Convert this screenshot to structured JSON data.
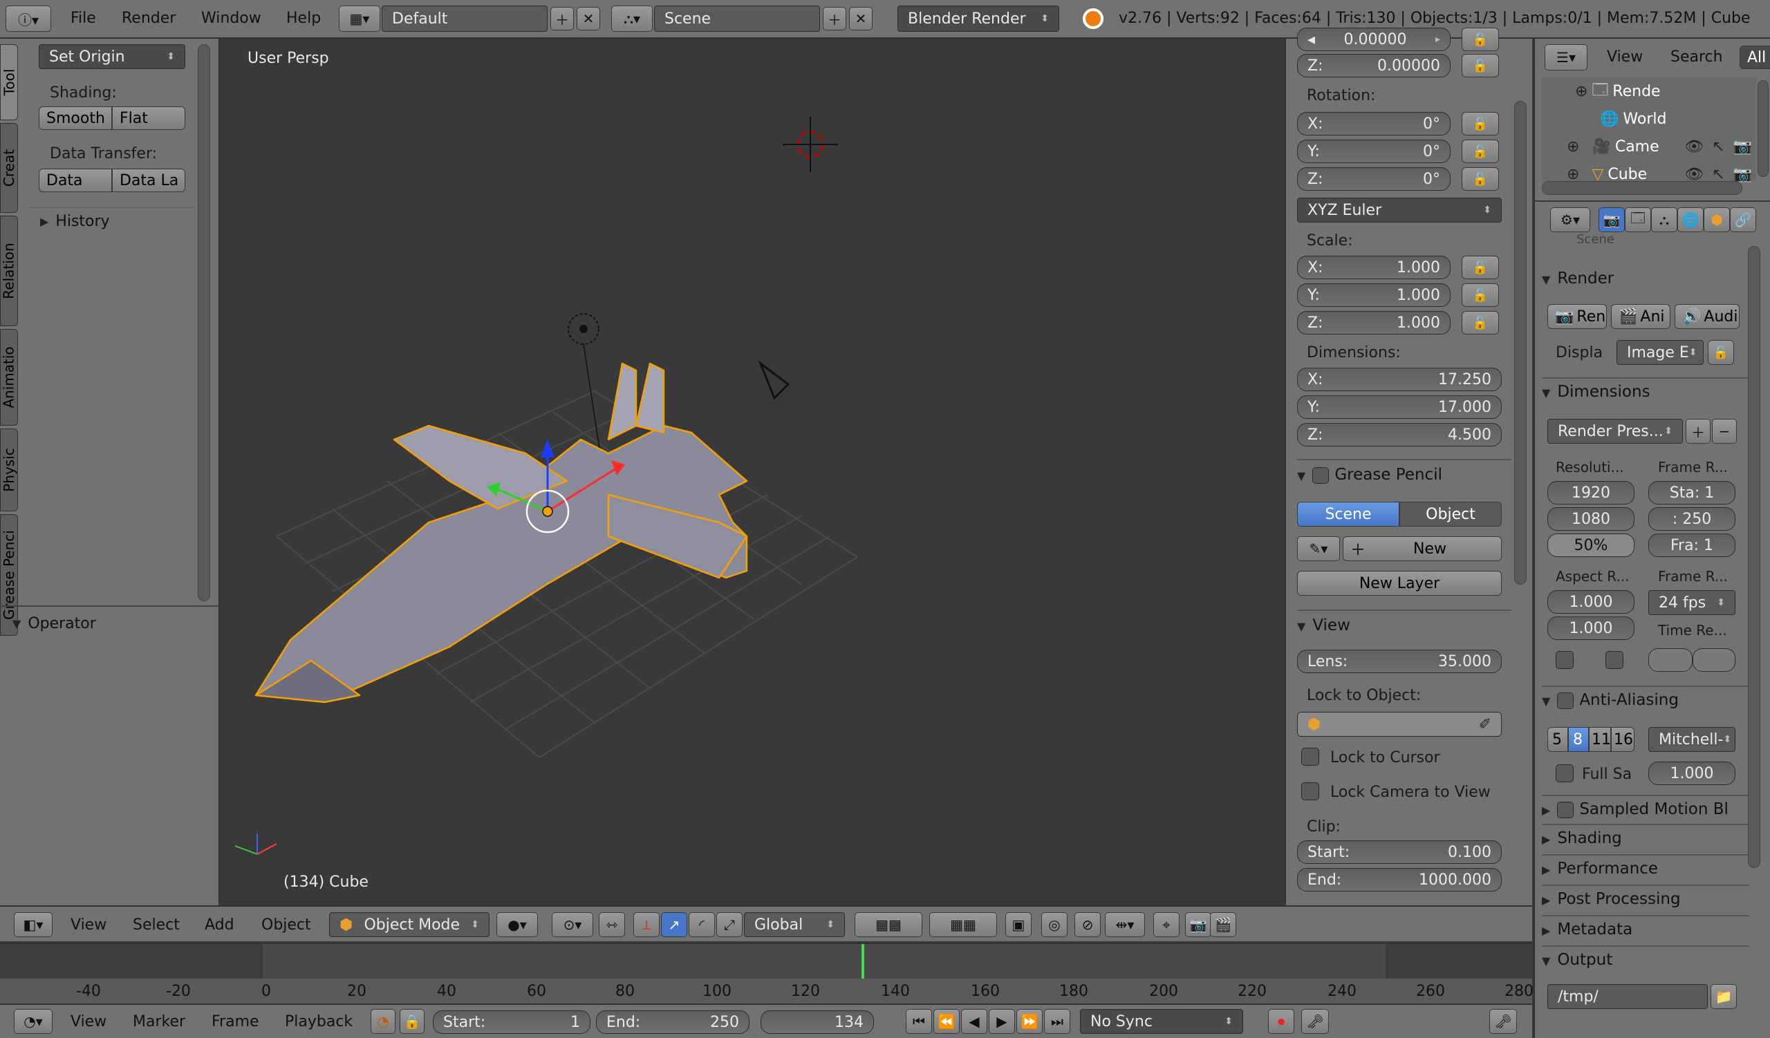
{
  "topbar": {
    "menus": [
      "File",
      "Render",
      "Window",
      "Help"
    ],
    "layout": "Default",
    "scene": "Scene",
    "engine": "Blender Render",
    "stats": "v2.76 | Verts:92 | Faces:64 | Tris:130 | Objects:1/3 | Lamps:0/1 | Mem:7.52M | Cube"
  },
  "toolshelf": {
    "tabs": [
      "Tool",
      "Creat",
      "Relation",
      "Animatio",
      "Physic",
      "Grease Penci"
    ],
    "set_origin": "Set Origin",
    "shading_label": "Shading:",
    "smooth": "Smooth",
    "flat": "Flat",
    "data_transfer_label": "Data Transfer:",
    "data": "Data",
    "data_la": "Data La",
    "history": "History",
    "operator": "Operator"
  },
  "viewport": {
    "view_name": "User Persp",
    "object_info": "(134) Cube"
  },
  "viewport_header": {
    "menus": [
      "View",
      "Select",
      "Add",
      "Object"
    ],
    "mode": "Object Mode",
    "orientation": "Global"
  },
  "properties_n": {
    "loc_z_label": "Z:",
    "loc_z": "0.00000",
    "loc_partial": "0.00000",
    "rotation_label": "Rotation:",
    "rot": [
      {
        "k": "X:",
        "v": "0°"
      },
      {
        "k": "Y:",
        "v": "0°"
      },
      {
        "k": "Z:",
        "v": "0°"
      }
    ],
    "rot_mode": "XYZ Euler",
    "scale_label": "Scale:",
    "scale": [
      {
        "k": "X:",
        "v": "1.000"
      },
      {
        "k": "Y:",
        "v": "1.000"
      },
      {
        "k": "Z:",
        "v": "1.000"
      }
    ],
    "dimensions_label": "Dimensions:",
    "dims": [
      {
        "k": "X:",
        "v": "17.250"
      },
      {
        "k": "Y:",
        "v": "17.000"
      },
      {
        "k": "Z:",
        "v": "4.500"
      }
    ],
    "grease_pencil": "Grease Pencil",
    "gp_scene": "Scene",
    "gp_object": "Object",
    "gp_new": "New",
    "gp_new_layer": "New Layer",
    "view": "View",
    "lens_label": "Lens:",
    "lens": "35.000",
    "lock_obj_label": "Lock to Object:",
    "lock_cursor": "Lock to Cursor",
    "lock_camera": "Lock Camera to View",
    "clip_label": "Clip:",
    "clip_start_label": "Start:",
    "clip_start": "0.100",
    "clip_end_label": "End:",
    "clip_end": "1000.000"
  },
  "outliner": {
    "menus": [
      "View",
      "Search",
      "All"
    ],
    "items": [
      {
        "name": "Rende"
      },
      {
        "name": "World"
      },
      {
        "name": "Came"
      },
      {
        "name": "Cube"
      }
    ]
  },
  "props": {
    "scene_label": "Scene",
    "render": "Render",
    "ren": "Ren",
    "ani": "Ani",
    "audi": "Audi",
    "displa": "Displa",
    "image_e": "Image E",
    "dimensions": "Dimensions",
    "render_presets": "Render Pres...",
    "resolution": "Resoluti...",
    "frame_r": "Frame R...",
    "res_x": "1920",
    "res_y": "1080",
    "res_pct": "50%",
    "sta": "Sta: 1",
    "end": ": 250",
    "fra": "Fra: 1",
    "aspect": "Aspect R...",
    "frame_rate": "Frame R...",
    "asp_x": "1.000",
    "asp_y": "1.000",
    "fps": "24 fps",
    "time_re": "Time Re...",
    "anti_aliasing": "Anti-Aliasing",
    "aa_samples": [
      "5",
      "8",
      "11",
      "16"
    ],
    "aa_filter": "Mitchell-",
    "full_sample": "Full Sa",
    "aa_size": "1.000",
    "sampled_motion": "Sampled Motion Bl",
    "shading": "Shading",
    "performance": "Performance",
    "post_processing": "Post Processing",
    "metadata": "Metadata",
    "output": "Output",
    "output_path": "/tmp/"
  },
  "timeline": {
    "ticks": [
      "-40",
      "-20",
      "0",
      "20",
      "40",
      "60",
      "80",
      "100",
      "120",
      "140",
      "160",
      "180",
      "200",
      "220",
      "240",
      "260",
      "280"
    ],
    "menus": [
      "View",
      "Marker",
      "Frame",
      "Playback"
    ],
    "start_label": "Start:",
    "start": "1",
    "end_label": "End:",
    "end": "250",
    "current": "134",
    "sync": "No Sync"
  }
}
